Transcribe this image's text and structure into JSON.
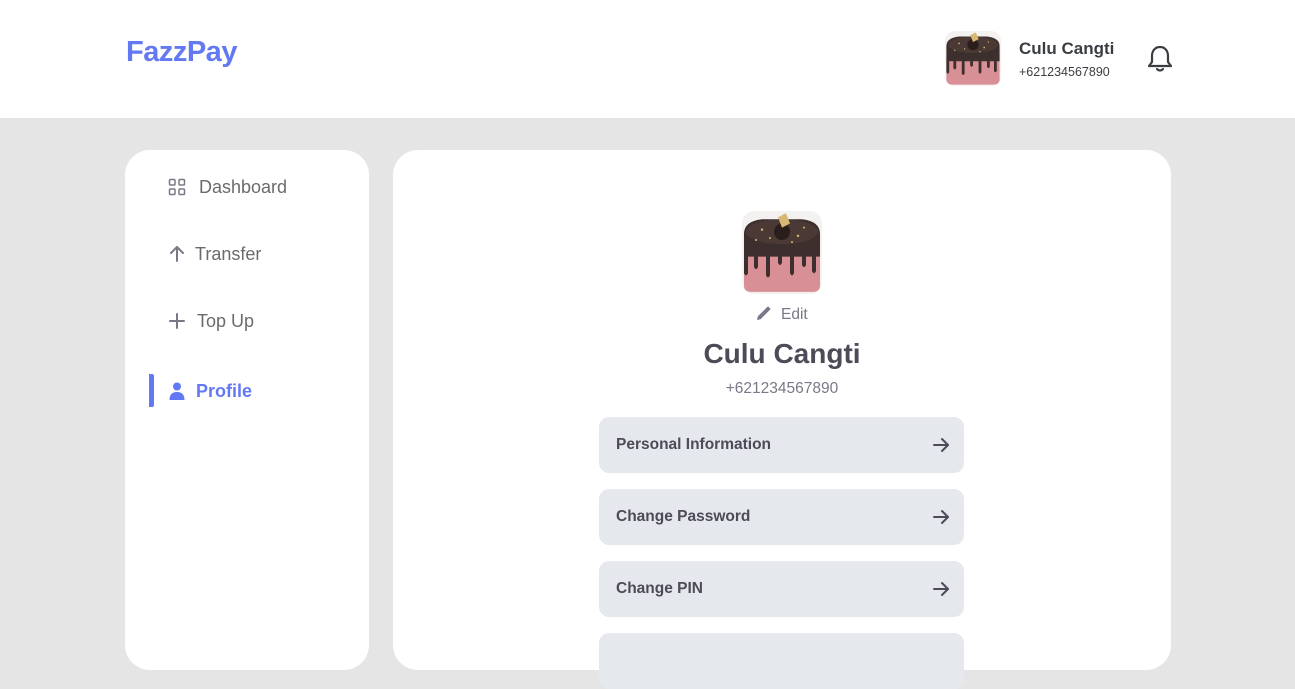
{
  "header": {
    "brand": "FazzPay",
    "user_name": "Culu Cangti",
    "user_phone": "+621234567890",
    "bell_icon": "bell-icon"
  },
  "sidebar": {
    "items": [
      {
        "label": "Dashboard",
        "icon": "grid-icon",
        "active": false
      },
      {
        "label": "Transfer",
        "icon": "arrow-up-icon",
        "active": false
      },
      {
        "label": "Top Up",
        "icon": "plus-icon",
        "active": false
      },
      {
        "label": "Profile",
        "icon": "user-icon",
        "active": true
      }
    ]
  },
  "profile": {
    "edit_label": "Edit",
    "name": "Culu Cangti",
    "phone": "+621234567890",
    "menu": [
      {
        "label": "Personal Information"
      },
      {
        "label": "Change Password"
      },
      {
        "label": "Change PIN"
      }
    ]
  },
  "colors": {
    "accent": "#6379f4",
    "page_bg": "#e5e5e5",
    "card_bg": "#ffffff",
    "button_bg": "#e5e8ed"
  }
}
